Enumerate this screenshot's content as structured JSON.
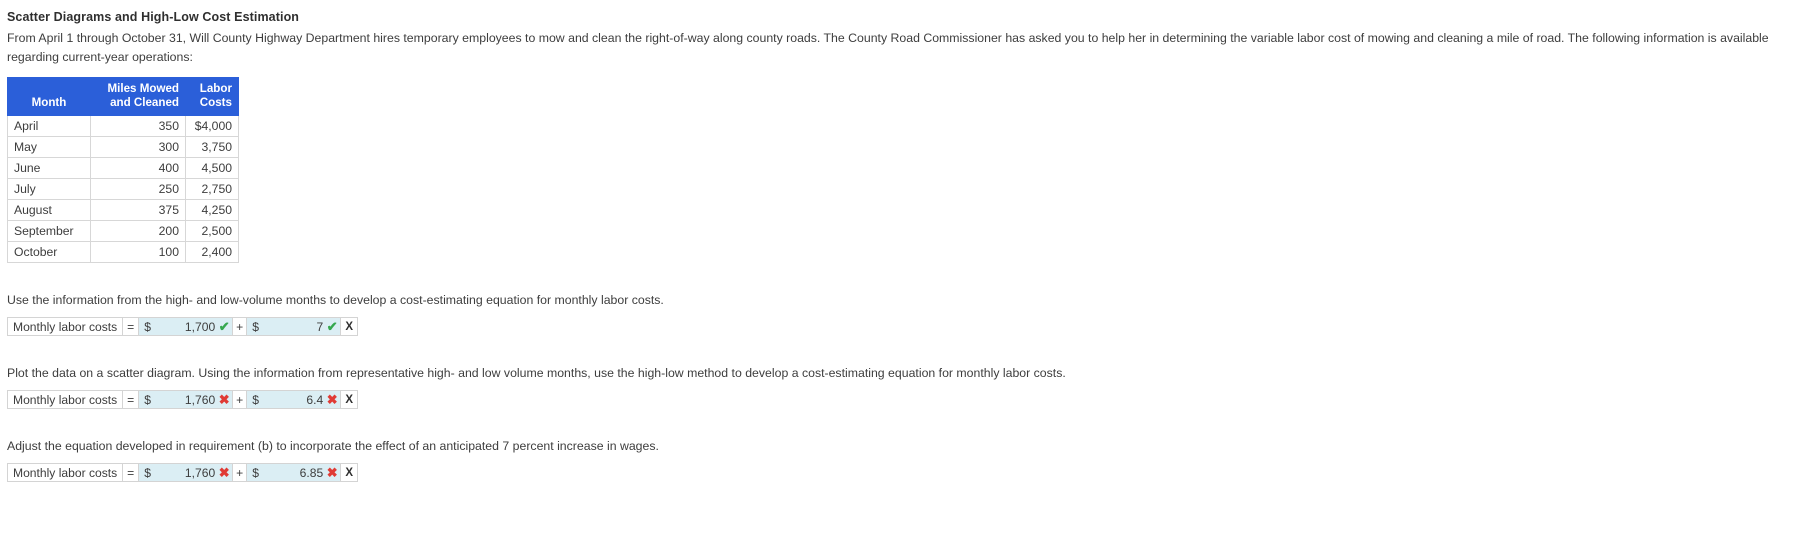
{
  "title": "Scatter Diagrams and High-Low Cost Estimation",
  "intro": "From April 1 through October 31, Will County Highway Department hires temporary employees to mow and clean the right-of-way along county roads. The County Road Commissioner has asked you to help her in determining the variable labor cost of mowing and cleaning a mile of road. The following information is available regarding current-year operations:",
  "table": {
    "headers": {
      "month": "Month",
      "miles_line1": "Miles Mowed",
      "miles_line2": "and Cleaned",
      "labor_line1": "Labor",
      "labor_line2": "Costs"
    },
    "rows": [
      {
        "month": "April",
        "miles": "350",
        "cost": "$4,000"
      },
      {
        "month": "May",
        "miles": "300",
        "cost": "3,750"
      },
      {
        "month": "June",
        "miles": "400",
        "cost": "4,500"
      },
      {
        "month": "July",
        "miles": "250",
        "cost": "2,750"
      },
      {
        "month": "August",
        "miles": "375",
        "cost": "4,250"
      },
      {
        "month": "September",
        "miles": "200",
        "cost": "2,500"
      },
      {
        "month": "October",
        "miles": "100",
        "cost": "2,400"
      }
    ]
  },
  "requirements": [
    {
      "text": "Use the information from the high- and low-volume months to develop a cost-estimating equation for monthly labor costs.",
      "answer": {
        "label": "Monthly labor costs",
        "equals": "=",
        "dollar1": "$",
        "value1": "1,700",
        "mark1": "✔",
        "mark1_state": "correct",
        "plus": "+",
        "dollar2": "$",
        "value2": "7",
        "mark2": "✔",
        "mark2_state": "correct",
        "suffix": "X"
      }
    },
    {
      "text": "Plot the data on a scatter diagram. Using the information from representative high- and low volume months, use the high-low method to develop a cost-estimating equation for monthly labor costs.",
      "answer": {
        "label": "Monthly labor costs",
        "equals": "=",
        "dollar1": "$",
        "value1": "1,760",
        "mark1": "✖",
        "mark1_state": "incorrect",
        "plus": "+",
        "dollar2": "$",
        "value2": "6.4",
        "mark2": "✖",
        "mark2_state": "incorrect",
        "suffix": "X"
      }
    },
    {
      "text": "Adjust the equation developed in requirement (b) to incorporate the effect of an anticipated 7 percent increase in wages.",
      "answer": {
        "label": "Monthly labor costs",
        "equals": "=",
        "dollar1": "$",
        "value1": "1,760",
        "mark1": "✖",
        "mark1_state": "incorrect",
        "plus": "+",
        "dollar2": "$",
        "value2": "6.85",
        "mark2": "✖",
        "mark2_state": "incorrect",
        "suffix": "X"
      }
    }
  ],
  "colors": {
    "header_blue": "#2b5fd9",
    "input_fill": "#dbeef4",
    "correct_green": "#36a84f",
    "incorrect_red": "#e03b35"
  }
}
